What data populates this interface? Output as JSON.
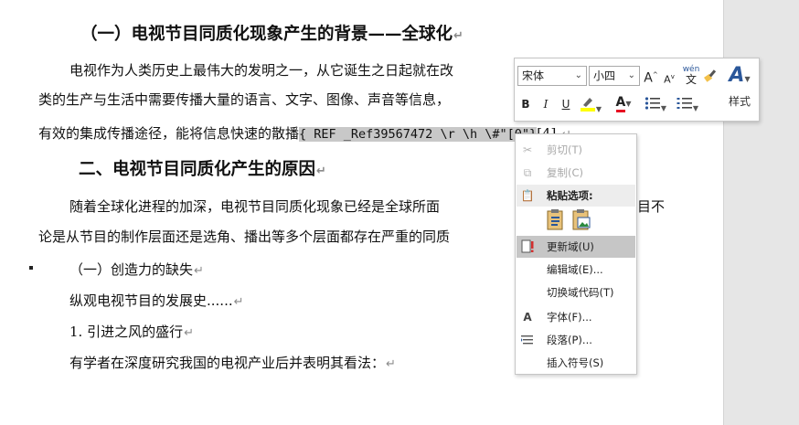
{
  "doc": {
    "heading1": "（一）电视节目同质化现象产生的背景——全球化",
    "para1_line1": "电视作为人类历史上最伟大的发明之一，从它诞生之日起就在改",
    "para1_line2": "类的生产与生活中需要传播大量的语言、文字、图像、声音等信息，",
    "para1_line3_a": "有效的集成传播途径，能将信息快速的散播",
    "field_code": "{ REF _Ref39567472 \\r \\h  \\#\"[0\"}",
    "para1_line3_b": "[4].",
    "heading2": "二、电视节目同质化产生的原因",
    "para2_line1_a": "随着全球化进程的加深，电视节目同质化现象已经是全球所面",
    "para2_line1_b": "目不",
    "para2_line2": "论是从节目的制作层面还是选角、播出等多个层面都存在严重的同质",
    "heading3": "（一）创造力的缺失",
    "para3": "纵观电视节目的发展史......",
    "list1": "1. 引进之风的盛行",
    "para4": "有学者在深度研究我国的电视产业后并表明其看法：",
    "para_mark": "↵"
  },
  "mini_toolbar": {
    "font_name": "宋体",
    "font_size": "小四",
    "grow_font": "A",
    "shrink_font": "A",
    "phonetic_top": "wén",
    "phonetic_bottom": "文",
    "bold": "B",
    "italic": "I",
    "underline": "U",
    "font_color_glyph": "A",
    "styles_glyph": "A",
    "styles_label": "样式",
    "highlight_color": "#ffff00",
    "font_color": "#e81123"
  },
  "context_menu": {
    "cut": "剪切(T)",
    "copy": "复制(C)",
    "paste_options": "粘贴选项:",
    "update_field": "更新域(U)",
    "edit_field": "编辑域(E)...",
    "toggle_field_codes": "切换域代码(T)",
    "font": "字体(F)...",
    "paragraph": "段落(P)...",
    "insert_symbol": "插入符号(S)"
  }
}
